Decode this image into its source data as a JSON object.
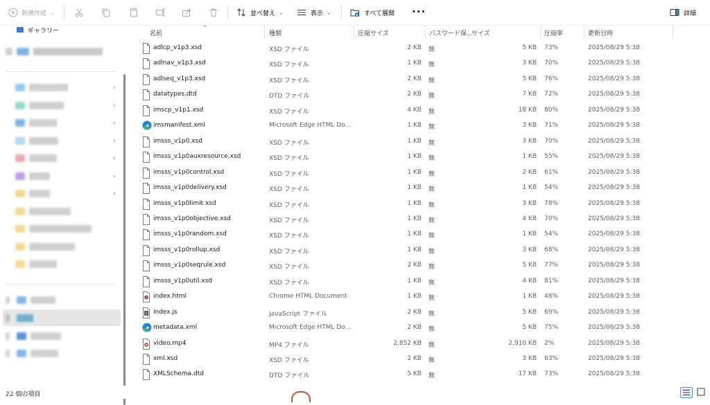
{
  "toolbar": {
    "new_label": "新規作成",
    "sort_label": "並べ替え",
    "view_label": "表示",
    "expand_all_label": "すべて展開",
    "more_label": "•••",
    "details_label": "詳細"
  },
  "sidebar": {
    "top_item_label": "ギャラリー"
  },
  "columns": {
    "name": "名前",
    "type": "種類",
    "compressed_size": "圧縮サイズ",
    "password": "パスワード保...",
    "size": "サイズ",
    "ratio": "圧縮率",
    "modified": "更新日時"
  },
  "files": [
    {
      "icon": "file-icon",
      "name": "adlcp_v1p3.xsd",
      "type": "XSD ファイル",
      "csize": "2 KB",
      "pw": "無",
      "size": "5 KB",
      "ratio": "73%",
      "date": "2025/08/29 5:38"
    },
    {
      "icon": "file-icon",
      "name": "adlnav_v1p3.xsd",
      "type": "XSD ファイル",
      "csize": "1 KB",
      "pw": "無",
      "size": "3 KB",
      "ratio": "70%",
      "date": "2025/08/29 5:38"
    },
    {
      "icon": "file-icon",
      "name": "adlseq_v1p3.xsd",
      "type": "XSD ファイル",
      "csize": "2 KB",
      "pw": "無",
      "size": "5 KB",
      "ratio": "76%",
      "date": "2025/08/29 5:38"
    },
    {
      "icon": "file-icon",
      "name": "datatypes.dtd",
      "type": "DTD ファイル",
      "csize": "2 KB",
      "pw": "無",
      "size": "7 KB",
      "ratio": "72%",
      "date": "2025/08/29 5:38"
    },
    {
      "icon": "file-icon",
      "name": "imscp_v1p1.xsd",
      "type": "XSD ファイル",
      "csize": "4 KB",
      "pw": "無",
      "size": "18 KB",
      "ratio": "80%",
      "date": "2025/08/29 5:38"
    },
    {
      "icon": "edge-icon",
      "name": "imsmanifest.xml",
      "type": "Microsoft Edge HTML Do...",
      "csize": "1 KB",
      "pw": "無",
      "size": "3 KB",
      "ratio": "71%",
      "date": "2025/08/29 5:38"
    },
    {
      "icon": "file-icon",
      "name": "imsss_v1p0.xsd",
      "type": "XSD ファイル",
      "csize": "1 KB",
      "pw": "無",
      "size": "3 KB",
      "ratio": "70%",
      "date": "2025/08/29 5:38"
    },
    {
      "icon": "file-icon",
      "name": "imsss_v1p0auxresource.xsd",
      "type": "XSD ファイル",
      "csize": "1 KB",
      "pw": "無",
      "size": "1 KB",
      "ratio": "55%",
      "date": "2025/08/29 5:38"
    },
    {
      "icon": "file-icon",
      "name": "imsss_v1p0control.xsd",
      "type": "XSD ファイル",
      "csize": "1 KB",
      "pw": "無",
      "size": "2 KB",
      "ratio": "61%",
      "date": "2025/08/29 5:38"
    },
    {
      "icon": "file-icon",
      "name": "imsss_v1p0delivery.xsd",
      "type": "XSD ファイル",
      "csize": "1 KB",
      "pw": "無",
      "size": "1 KB",
      "ratio": "54%",
      "date": "2025/08/29 5:38"
    },
    {
      "icon": "file-icon",
      "name": "imsss_v1p0limit.xsd",
      "type": "XSD ファイル",
      "csize": "1 KB",
      "pw": "無",
      "size": "3 KB",
      "ratio": "78%",
      "date": "2025/08/29 5:38"
    },
    {
      "icon": "file-icon",
      "name": "imsss_v1p0objective.xsd",
      "type": "XSD ファイル",
      "csize": "1 KB",
      "pw": "無",
      "size": "4 KB",
      "ratio": "70%",
      "date": "2025/08/29 5:38"
    },
    {
      "icon": "file-icon",
      "name": "imsss_v1p0random.xsd",
      "type": "XSD ファイル",
      "csize": "1 KB",
      "pw": "無",
      "size": "1 KB",
      "ratio": "54%",
      "date": "2025/08/29 5:38"
    },
    {
      "icon": "file-icon",
      "name": "imsss_v1p0rollup.xsd",
      "type": "XSD ファイル",
      "csize": "1 KB",
      "pw": "無",
      "size": "3 KB",
      "ratio": "68%",
      "date": "2025/08/29 5:38"
    },
    {
      "icon": "file-icon",
      "name": "imsss_v1p0seqrule.xsd",
      "type": "XSD ファイル",
      "csize": "2 KB",
      "pw": "無",
      "size": "5 KB",
      "ratio": "77%",
      "date": "2025/08/29 5:38"
    },
    {
      "icon": "file-icon",
      "name": "imsss_v1p0util.xsd",
      "type": "XSD ファイル",
      "csize": "1 KB",
      "pw": "無",
      "size": "4 KB",
      "ratio": "81%",
      "date": "2025/08/29 5:38"
    },
    {
      "icon": "chrome-html-icon",
      "name": "index.html",
      "type": "Chrome HTML Document",
      "csize": "1 KB",
      "pw": "無",
      "size": "1 KB",
      "ratio": "48%",
      "date": "2025/08/29 5:38"
    },
    {
      "icon": "js-icon",
      "name": "index.js",
      "type": "JavaScript ファイル",
      "csize": "2 KB",
      "pw": "無",
      "size": "5 KB",
      "ratio": "69%",
      "date": "2025/08/29 5:38"
    },
    {
      "icon": "edge-icon",
      "name": "metadata.xml",
      "type": "Microsoft Edge HTML Do...",
      "csize": "2 KB",
      "pw": "無",
      "size": "5 KB",
      "ratio": "75%",
      "date": "2025/08/29 5:38"
    },
    {
      "icon": "video-icon",
      "name": "video.mp4",
      "type": "MP4 ファイル",
      "csize": "2,852 KB",
      "pw": "無",
      "size": "2,910 KB",
      "ratio": "2%",
      "date": "2025/08/29 5:38"
    },
    {
      "icon": "file-icon",
      "name": "xml.xsd",
      "type": "XSD ファイル",
      "csize": "2 KB",
      "pw": "無",
      "size": "3 KB",
      "ratio": "63%",
      "date": "2025/08/29 5:38"
    },
    {
      "icon": "file-icon",
      "name": "XMLSchema.dtd",
      "type": "DTD ファイル",
      "csize": "5 KB",
      "pw": "無",
      "size": "17 KB",
      "ratio": "73%",
      "date": "2025/08/29 5:38"
    }
  ],
  "status": {
    "item_count": "22 個の項目"
  },
  "colors": {
    "accent": "#0067c0",
    "edge_blue": "#1f8ad2",
    "edge_green": "#3cc16b",
    "selected_bg": "#e6e6e6"
  }
}
